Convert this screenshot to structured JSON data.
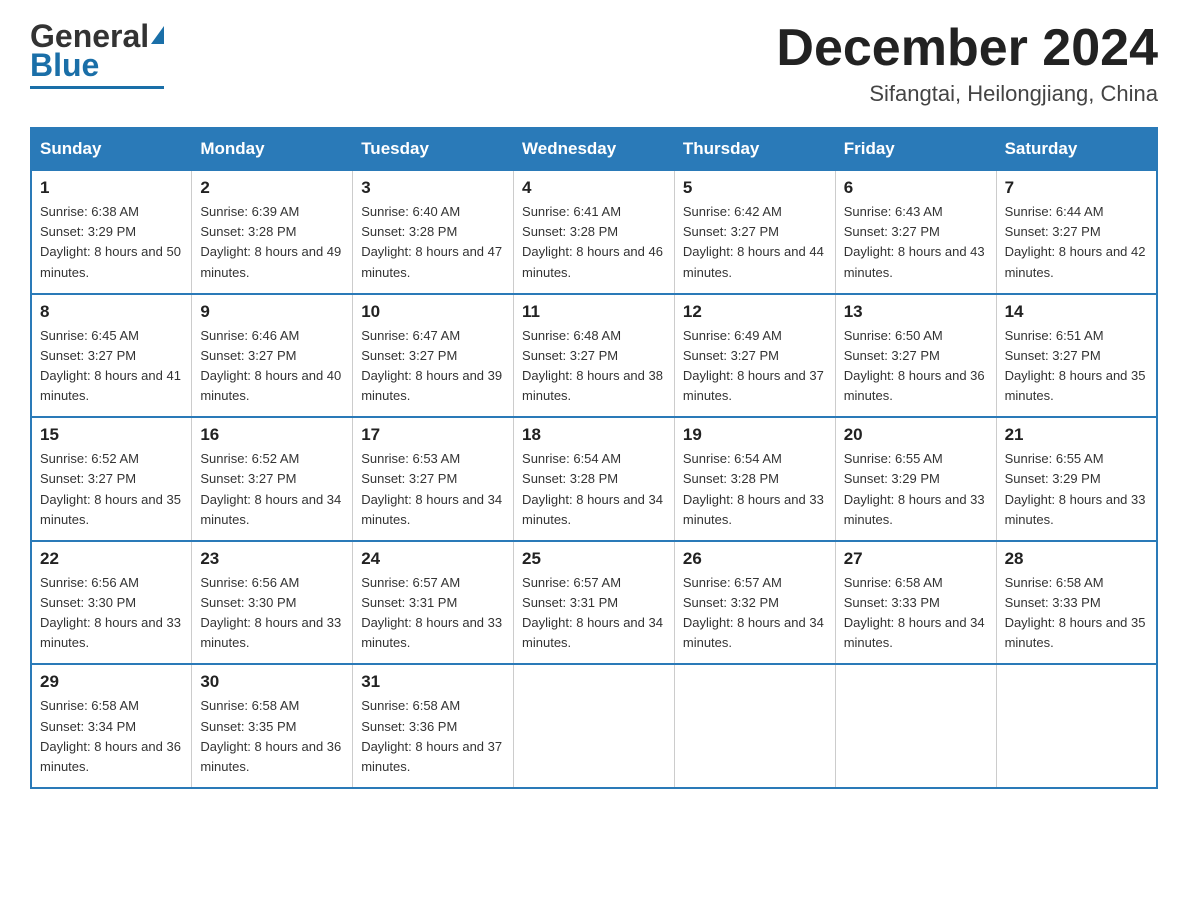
{
  "header": {
    "logo_general": "General",
    "logo_blue": "Blue",
    "month_year": "December 2024",
    "location": "Sifangtai, Heilongjiang, China"
  },
  "weekdays": [
    "Sunday",
    "Monday",
    "Tuesday",
    "Wednesday",
    "Thursday",
    "Friday",
    "Saturday"
  ],
  "weeks": [
    [
      {
        "day": "1",
        "sunrise": "6:38 AM",
        "sunset": "3:29 PM",
        "daylight": "8 hours and 50 minutes."
      },
      {
        "day": "2",
        "sunrise": "6:39 AM",
        "sunset": "3:28 PM",
        "daylight": "8 hours and 49 minutes."
      },
      {
        "day": "3",
        "sunrise": "6:40 AM",
        "sunset": "3:28 PM",
        "daylight": "8 hours and 47 minutes."
      },
      {
        "day": "4",
        "sunrise": "6:41 AM",
        "sunset": "3:28 PM",
        "daylight": "8 hours and 46 minutes."
      },
      {
        "day": "5",
        "sunrise": "6:42 AM",
        "sunset": "3:27 PM",
        "daylight": "8 hours and 44 minutes."
      },
      {
        "day": "6",
        "sunrise": "6:43 AM",
        "sunset": "3:27 PM",
        "daylight": "8 hours and 43 minutes."
      },
      {
        "day": "7",
        "sunrise": "6:44 AM",
        "sunset": "3:27 PM",
        "daylight": "8 hours and 42 minutes."
      }
    ],
    [
      {
        "day": "8",
        "sunrise": "6:45 AM",
        "sunset": "3:27 PM",
        "daylight": "8 hours and 41 minutes."
      },
      {
        "day": "9",
        "sunrise": "6:46 AM",
        "sunset": "3:27 PM",
        "daylight": "8 hours and 40 minutes."
      },
      {
        "day": "10",
        "sunrise": "6:47 AM",
        "sunset": "3:27 PM",
        "daylight": "8 hours and 39 minutes."
      },
      {
        "day": "11",
        "sunrise": "6:48 AM",
        "sunset": "3:27 PM",
        "daylight": "8 hours and 38 minutes."
      },
      {
        "day": "12",
        "sunrise": "6:49 AM",
        "sunset": "3:27 PM",
        "daylight": "8 hours and 37 minutes."
      },
      {
        "day": "13",
        "sunrise": "6:50 AM",
        "sunset": "3:27 PM",
        "daylight": "8 hours and 36 minutes."
      },
      {
        "day": "14",
        "sunrise": "6:51 AM",
        "sunset": "3:27 PM",
        "daylight": "8 hours and 35 minutes."
      }
    ],
    [
      {
        "day": "15",
        "sunrise": "6:52 AM",
        "sunset": "3:27 PM",
        "daylight": "8 hours and 35 minutes."
      },
      {
        "day": "16",
        "sunrise": "6:52 AM",
        "sunset": "3:27 PM",
        "daylight": "8 hours and 34 minutes."
      },
      {
        "day": "17",
        "sunrise": "6:53 AM",
        "sunset": "3:27 PM",
        "daylight": "8 hours and 34 minutes."
      },
      {
        "day": "18",
        "sunrise": "6:54 AM",
        "sunset": "3:28 PM",
        "daylight": "8 hours and 34 minutes."
      },
      {
        "day": "19",
        "sunrise": "6:54 AM",
        "sunset": "3:28 PM",
        "daylight": "8 hours and 33 minutes."
      },
      {
        "day": "20",
        "sunrise": "6:55 AM",
        "sunset": "3:29 PM",
        "daylight": "8 hours and 33 minutes."
      },
      {
        "day": "21",
        "sunrise": "6:55 AM",
        "sunset": "3:29 PM",
        "daylight": "8 hours and 33 minutes."
      }
    ],
    [
      {
        "day": "22",
        "sunrise": "6:56 AM",
        "sunset": "3:30 PM",
        "daylight": "8 hours and 33 minutes."
      },
      {
        "day": "23",
        "sunrise": "6:56 AM",
        "sunset": "3:30 PM",
        "daylight": "8 hours and 33 minutes."
      },
      {
        "day": "24",
        "sunrise": "6:57 AM",
        "sunset": "3:31 PM",
        "daylight": "8 hours and 33 minutes."
      },
      {
        "day": "25",
        "sunrise": "6:57 AM",
        "sunset": "3:31 PM",
        "daylight": "8 hours and 34 minutes."
      },
      {
        "day": "26",
        "sunrise": "6:57 AM",
        "sunset": "3:32 PM",
        "daylight": "8 hours and 34 minutes."
      },
      {
        "day": "27",
        "sunrise": "6:58 AM",
        "sunset": "3:33 PM",
        "daylight": "8 hours and 34 minutes."
      },
      {
        "day": "28",
        "sunrise": "6:58 AM",
        "sunset": "3:33 PM",
        "daylight": "8 hours and 35 minutes."
      }
    ],
    [
      {
        "day": "29",
        "sunrise": "6:58 AM",
        "sunset": "3:34 PM",
        "daylight": "8 hours and 36 minutes."
      },
      {
        "day": "30",
        "sunrise": "6:58 AM",
        "sunset": "3:35 PM",
        "daylight": "8 hours and 36 minutes."
      },
      {
        "day": "31",
        "sunrise": "6:58 AM",
        "sunset": "3:36 PM",
        "daylight": "8 hours and 37 minutes."
      },
      null,
      null,
      null,
      null
    ]
  ]
}
